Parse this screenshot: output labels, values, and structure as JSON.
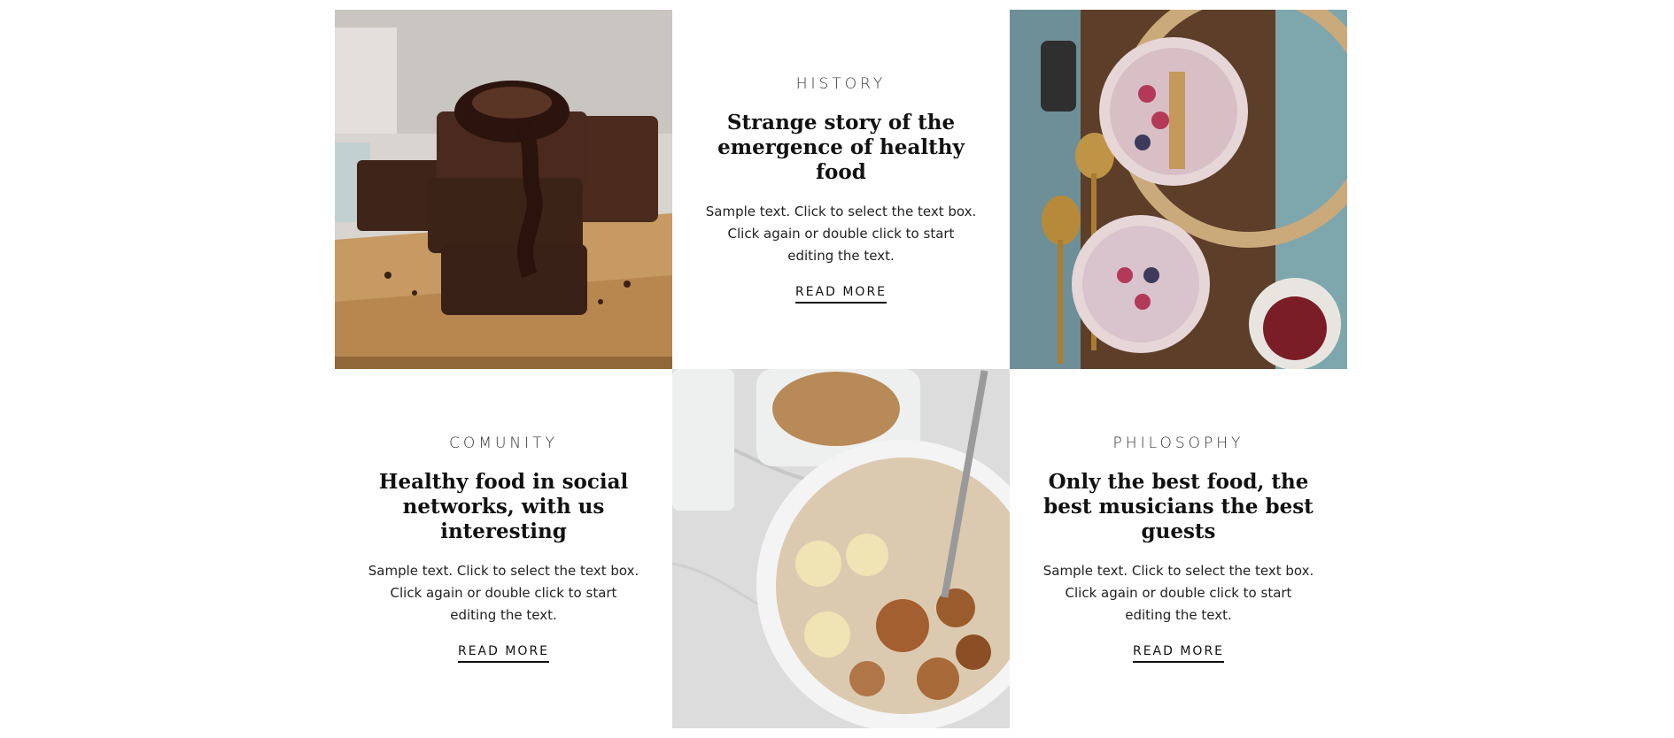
{
  "cards": [
    {
      "category": "HISTORY",
      "headline": "Strange story of the emergence of healthy food",
      "body": "Sample text. Click to select the text box. Click again or double click to start editing the text.",
      "link": "READ MORE"
    },
    {
      "category": "COMUNITY",
      "headline": "Healthy food in social networks, with us interesting",
      "body": "Sample text. Click to select the text box. Click again or double click to start editing the text.",
      "link": "READ MORE"
    },
    {
      "category": "PHILOSOPHY",
      "headline": "Only the best food, the best musicians the best guests",
      "body": "Sample text. Click to select the text box. Click again or double click to start editing the text.",
      "link": "READ MORE"
    }
  ],
  "images": {
    "brownies": "brownies-photo",
    "smoothie_bowls": "smoothie-bowls-photo",
    "oatmeal_bowl": "oatmeal-bowl-photo"
  }
}
